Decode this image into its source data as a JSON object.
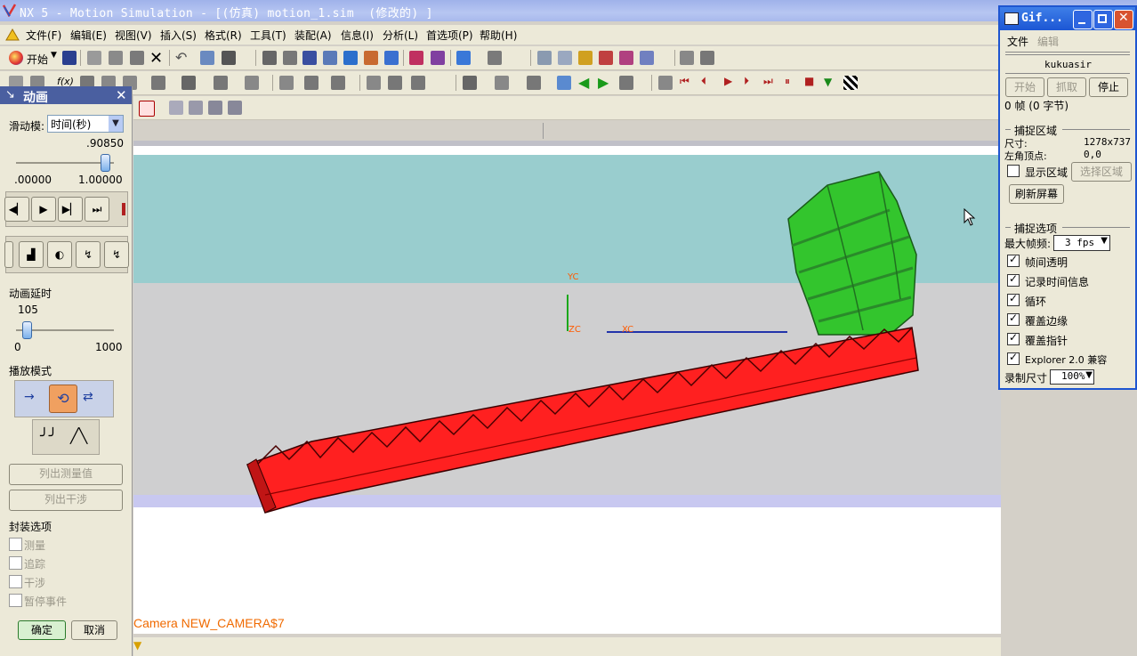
{
  "window": {
    "title": "NX 5 - Motion Simulation - [(仿真) motion_1.sim  (修改的) ]"
  },
  "menu": {
    "items": [
      "文件(F)",
      "编辑(E)",
      "视图(V)",
      "插入(S)",
      "格式(R)",
      "工具(T)",
      "装配(A)",
      "信息(I)",
      "分析(L)",
      "首选项(P)",
      "帮助(H)"
    ]
  },
  "toolbar": {
    "start_label": "开始",
    "start_icon": "start-icon"
  },
  "viewport": {
    "axis_labels": {
      "yc": "YC",
      "zc": "ZC",
      "xc": "XC"
    },
    "camera_label": "Camera NEW_CAMERA$7",
    "colors": {
      "sky": "#99cdce",
      "floor": "#cfcfd0",
      "rack": "#ff2020",
      "gear": "#33c52d"
    }
  },
  "animation_panel": {
    "title": "动画",
    "slider_mode_label": "滑动模:",
    "slider_mode_value": "时间(秒)",
    "time_value": ".90850",
    "time_min": ".00000",
    "time_max": "1.00000",
    "time_fraction": 0.9085,
    "delay_label": "动画延时",
    "delay_value": "105",
    "delay_min": "0",
    "delay_max": "1000",
    "delay_fraction": 0.105,
    "play_mode_label": "播放模式",
    "list_measure_label": "列出测量值",
    "list_interference_label": "列出干涉",
    "package_options_label": "封装选项",
    "options": [
      "测量",
      "追踪",
      "干涉",
      "暂停事件"
    ],
    "ok_label": "确定",
    "cancel_label": "取消"
  },
  "gif_window": {
    "title": "Gif...",
    "menu_file": "文件",
    "menu_edit": "编辑",
    "name": "kukuasir",
    "start_label": "开始",
    "grab_label": "抓取",
    "stop_label": "停止",
    "frames_text": "0 帧 (0 字节)",
    "capture_area_label": "捕捉区域",
    "size_label": "尺寸:",
    "size_value": "1278x737",
    "topleft_label": "左角顶点:",
    "topleft_value": "0,0",
    "show_area_label": "显示区域",
    "select_area_label": "选择区域",
    "refresh_label": "刷新屏幕",
    "capture_options_label": "捕捉选项",
    "max_fps_label": "最大帧频:",
    "max_fps_value": "3 fps",
    "options": [
      {
        "label": "帧间透明",
        "checked": true
      },
      {
        "label": "记录时间信息",
        "checked": true
      },
      {
        "label": "循环",
        "checked": true
      },
      {
        "label": "覆盖边缘",
        "checked": true
      },
      {
        "label": "覆盖指针",
        "checked": true
      },
      {
        "label": "Explorer 2.0 兼容",
        "checked": true
      }
    ],
    "record_size_label": "录制尺寸",
    "record_size_value": "100%"
  }
}
